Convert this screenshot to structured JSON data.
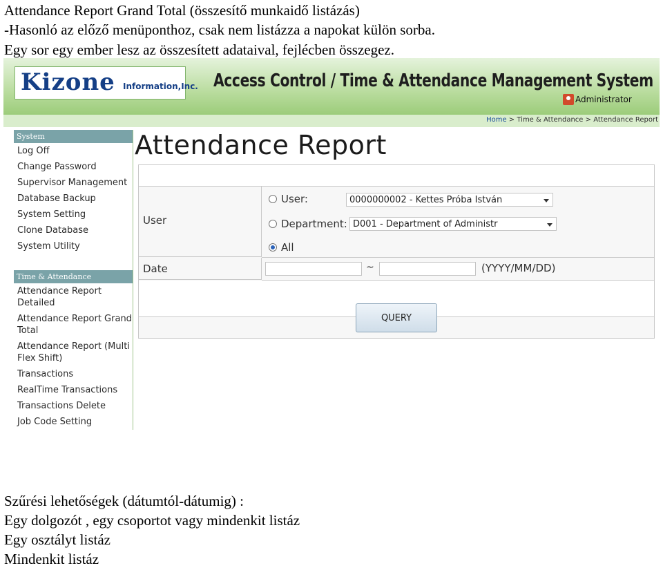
{
  "doc": {
    "intro_lines": [
      "Attendance Report Grand Total (összesítő munkaidő listázás)",
      "-Hasonló az előző menüponthoz, csak nem listázza a napokat külön sorba.",
      "Egy sor egy ember lesz az összesített adataival, fejlécben összegez."
    ],
    "bottom_lines": [
      "Szűrési lehetőségek (dátumtól-dátumig) :",
      "Egy dolgozót , egy csoportot vagy mindenkit listáz",
      "Egy osztályt listáz",
      "Mindenkit listáz"
    ]
  },
  "header": {
    "logo": "Kizone",
    "logo_sub": "Information,Inc.",
    "system_title": "Access Control / Time & Attendance Management System",
    "user": "Administrator"
  },
  "breadcrumb": {
    "home": "Home",
    "separator": " > ",
    "section": "Time & Attendance",
    "page": "Attendance Report"
  },
  "sidebar": {
    "system_header": "System",
    "system_items": [
      "Log Off",
      "Change Password",
      "Supervisor Management",
      "Database Backup",
      "System Setting",
      "Clone Database",
      "System Utility"
    ],
    "ta_header": "Time & Attendance",
    "ta_items": [
      "Attendance Report Detailed",
      "Attendance Report Grand Total",
      "Attendance Report (Multi Flex Shift)",
      "Transactions",
      "RealTime Transactions",
      "Transactions Delete",
      "Job Code Setting"
    ]
  },
  "main": {
    "title": "Attendance Report",
    "user_label": "User",
    "date_label": "Date",
    "radio_user": "User:",
    "radio_department": "Department:",
    "radio_all": "All",
    "selected_radio": "All",
    "user_select": "0000000002 - Kettes Próba István",
    "department_select": "D001 - Department of Administr",
    "date_from": "",
    "date_to": "",
    "date_sep": "~",
    "date_format": "(YYYY/MM/DD)",
    "query_button": "QUERY"
  },
  "colors": {
    "header_green": "#b9dc9e",
    "sidebar_header": "#7aa3a8",
    "logo_blue": "#153f86"
  }
}
